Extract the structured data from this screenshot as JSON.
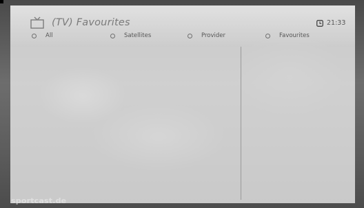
{
  "header": {
    "title": "(TV) Favourites",
    "time": "21:33",
    "title_icon": "tv-icon",
    "clock_icon": "clock-icon"
  },
  "filters": [
    {
      "label": "All",
      "icon": "radio-icon"
    },
    {
      "label": "Satellites",
      "icon": "radio-icon"
    },
    {
      "label": "Provider",
      "icon": "radio-icon"
    },
    {
      "label": "Favourites",
      "icon": "radio-icon"
    }
  ],
  "watermark": "sportcast.de",
  "colors": {
    "panel": "#e8e8e8",
    "title": "#7a7a7a",
    "text": "#555555",
    "divider": "#9a9a9a"
  }
}
